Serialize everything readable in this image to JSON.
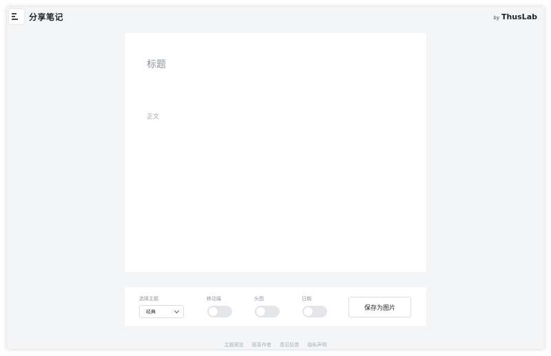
{
  "header": {
    "app_title": "分享笔记",
    "brand_by": "by",
    "brand_name": "ThusLab"
  },
  "note": {
    "title_placeholder": "标题",
    "body_placeholder": "正文"
  },
  "controls": {
    "theme_label": "选择主题",
    "theme_value": "经典",
    "mobile_label": "移动端",
    "mobile_on": false,
    "header_image_label": "头图",
    "header_image_on": false,
    "date_label": "日期",
    "date_on": false,
    "save_label": "保存为图片"
  },
  "footer": {
    "links": [
      "主题预览",
      "联系作者",
      "意见反馈",
      "隐私声明"
    ]
  }
}
